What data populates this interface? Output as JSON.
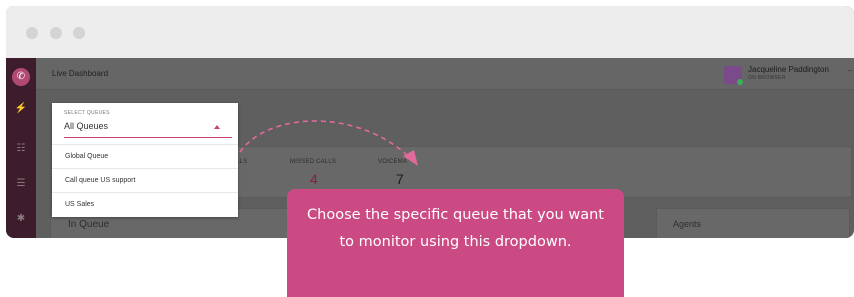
{
  "header": {
    "title": "Live Dashboard",
    "user": {
      "name": "Jacqueline Paddington",
      "status": "ON BROWSER",
      "menu_icon": "dash-icon"
    }
  },
  "sidebar": {
    "logo_icon": "phone-icon",
    "items": [
      {
        "icon": "dashboard-icon",
        "active": true
      },
      {
        "icon": "people-icon",
        "active": false
      },
      {
        "icon": "list-icon",
        "active": false
      },
      {
        "icon": "gear-icon",
        "active": false
      }
    ]
  },
  "queue_selector": {
    "caption": "SELECT QUEUES",
    "selected": "All Queues",
    "options": [
      "Global Queue",
      "Call queue US support",
      "US Sales"
    ]
  },
  "stats": [
    {
      "label": "LLS",
      "value": ""
    },
    {
      "label": "MISSED CALLS",
      "value": "4",
      "color": "#8a1e3f"
    },
    {
      "label": "VOICEMA",
      "value": "7",
      "color": "#1c1c1c"
    }
  ],
  "panels": {
    "in_queue_title": "In Queue",
    "agents_title": "Agents"
  },
  "tooltip": {
    "text": "Choose the specific queue that you want to monitor using this dropdown."
  },
  "colors": {
    "accent": "#cc4a83",
    "rail": "#3d1d2c"
  }
}
